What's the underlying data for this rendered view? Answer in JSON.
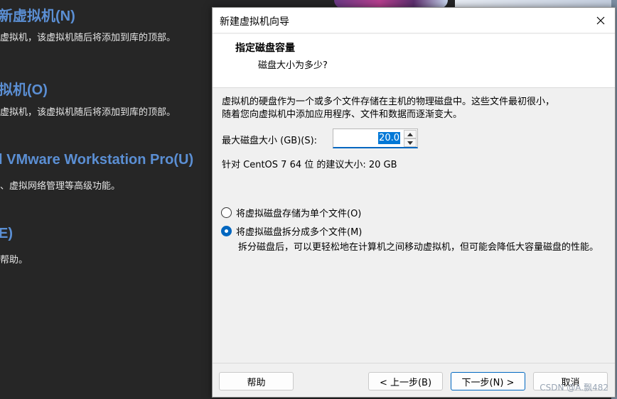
{
  "background": {
    "items": [
      {
        "title": "新虚拟机(N)",
        "desc": "虚拟机，该虚拟机随后将添加到库的顶部。"
      },
      {
        "title": "拟机(O)",
        "desc": "虚拟机，该虚拟机随后将添加到库的顶部。"
      },
      {
        "title": "l VMware Workstation Pro(U)",
        "desc": "、虚拟网络管理等高级功能。"
      },
      {
        "title": "E)",
        "desc": "帮助。"
      }
    ]
  },
  "dialog": {
    "title": "新建虚拟机向导",
    "header_title": "指定磁盘容量",
    "header_subtitle": "磁盘大小为多少?",
    "intro_line1": "虚拟机的硬盘作为一个或多个文件存储在主机的物理磁盘中。这些文件最初很小，",
    "intro_line2": "随着您向虚拟机中添加应用程序、文件和数据而逐渐变大。",
    "max_size_label": "最大磁盘大小 (GB)(S):",
    "max_size_value": "20.0",
    "recommend_text": "针对 CentOS 7 64 位 的建议大小: 20 GB",
    "option_single": "将虚拟磁盘存储为单个文件(O)",
    "option_multi": "将虚拟磁盘拆分成多个文件(M)",
    "split_note": "拆分磁盘后，可以更轻松地在计算机之间移动虚拟机，但可能会降低大容量磁盘的性能。",
    "buttons": {
      "help": "帮助",
      "back": "< 上一步(B)",
      "next": "下一步(N) >",
      "cancel": "取消"
    }
  },
  "watermark": "CSDN @A.飘482",
  "colors": {
    "accent": "#0067c0",
    "bg_title": "#5b8fd4"
  }
}
